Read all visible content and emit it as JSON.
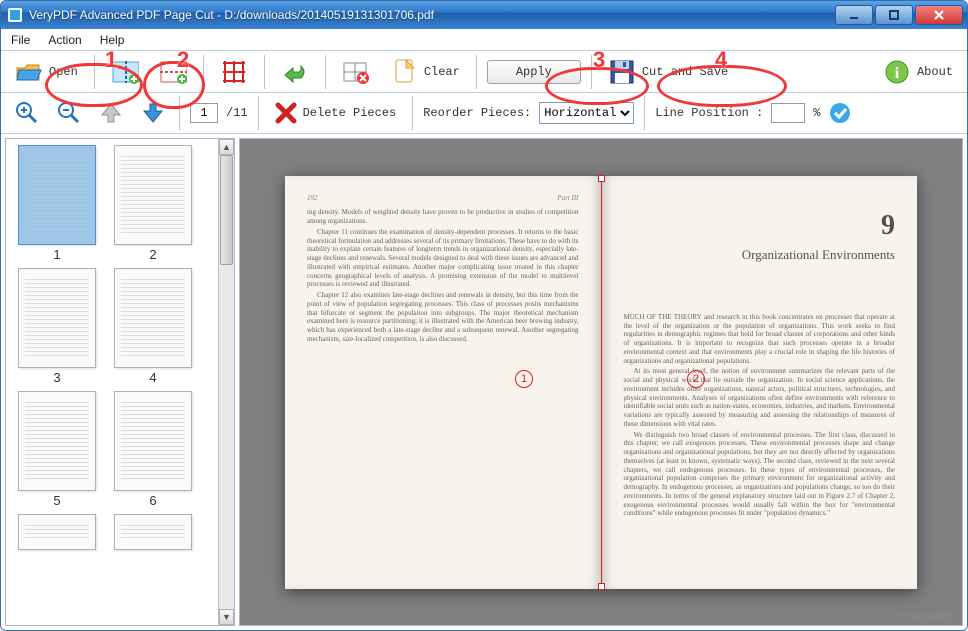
{
  "title": "VeryPDF Advanced PDF Page Cut - D:/downloads/20140519131301706.pdf",
  "menubar": {
    "file": "File",
    "action": "Action",
    "help": "Help"
  },
  "toolbar1": {
    "open": "Open",
    "clear": "Clear",
    "apply": "Apply",
    "cut_save": "Cut and Save",
    "about": "About"
  },
  "toolbar2": {
    "page_value": "1",
    "page_total": "/11",
    "delete_pieces": "Delete Pieces",
    "reorder_label": "Reorder Pieces:",
    "reorder_value": "Horizontal",
    "line_pos_label": "Line Position :",
    "line_pos_value": "",
    "line_pos_unit": "%"
  },
  "thumbs": [
    {
      "label": "1",
      "selected": true
    },
    {
      "label": "2",
      "selected": false
    },
    {
      "label": "3",
      "selected": false
    },
    {
      "label": "4",
      "selected": false
    },
    {
      "label": "5",
      "selected": false
    },
    {
      "label": "6",
      "selected": false
    }
  ],
  "preview": {
    "left_header_num": "192",
    "left_header_title": "Part III",
    "right_chapter_num": "9",
    "right_chapter_title": "Organizational Environments",
    "left_body": [
      "ing density. Models of weighted density have proven to be productive in studies of competition among organizations.",
      "Chapter 11 continues the examination of density-dependent processes. It returns to the basic theoretical formulation and addresses several of its primary limitations. These have to do with its inability to explain certain features of longterm trends in organizational density, especially late-stage declines and renewals. Several models designed to deal with these issues are advanced and illustrated with empirical estimates. Another major complicating issue treated in this chapter concerns geographical levels of analysis. A promising extension of the model to multilevel processes is reviewed and illustrated.",
      "Chapter 12 also examines late-stage declines and renewals in density, but this time from the point of view of population segregating processes. This class of processes posits mechanisms that bifurcate or segment the population into subgroups. The major theoretical mechanism examined here is resource partitioning; it is illustrated with the American beer brewing industry, which has experienced both a late-stage decline and a subsequent renewal. Another segregating mechanism, size-localized competition, is also discussed."
    ],
    "right_body": [
      "MUCH OF THE THEORY and research in this book concentrates on processes that operate at the level of the organization or the population of organizations. This work seeks to find regularities in demographic regimes that hold for broad classes of corporations and other kinds of organizations. It is important to recognize that such processes operate in a broader environmental context and that environments play a crucial role in shaping the life histories of organizations and organizational populations.",
      "At its most general level, the notion of environment summarizes the relevant parts of the social and physical world that lie outside the organization. In social science applications, the environment includes other organizations, natural actors, political structures, technologies, and physical environments. Analyses of organizations often define environments with reference to identifiable social units such as nation-states, economies, industries, and markets. Environmental variations are typically assessed by measuring and assessing the relationships of measures of these dimensions with vital rates.",
      "We distinguish two broad classes of environmental processes. The first class, discussed in this chapter, we call exogenous processes. These environmental processes shape and change organizations and organizational populations, but they are not directly affected by organizations themselves (at least in known, systematic ways). The second class, reviewed in the next several chapters, we call endogenous processes. In these types of environmental processes, the organizational population comprises the primary environment for organizational activity and demography. In endogenous processes, as organizations and populations change, so too do their environments. In terms of the general explanatory structure laid out in Figure 2.7 of Chapter 2, exogenous environmental processes would usually fall within the box for \"environmental conditions\" while endogenous processes fit under \"population dynamics.\""
    ],
    "callouts": {
      "one": "1",
      "two": "2"
    }
  },
  "annotations": {
    "n1": "1",
    "n2": "2",
    "n3": "3",
    "n4": "4"
  },
  "watermark": "© VeryPDF"
}
